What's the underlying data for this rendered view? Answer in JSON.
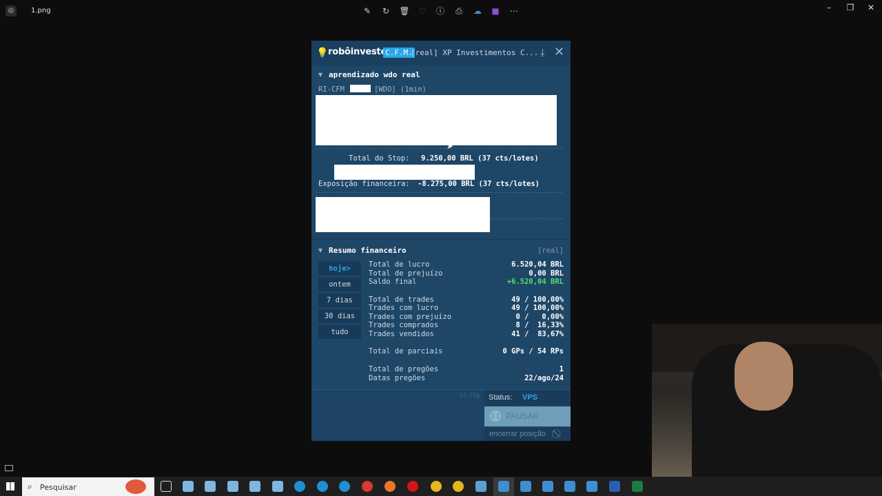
{
  "viewer": {
    "filename": "1.png",
    "toolbar_icons": [
      "edit-icon",
      "rotate-icon",
      "delete-icon",
      "heart-icon",
      "info-icon",
      "print-icon",
      "onedrive-icon",
      "clipchamp-icon",
      "more-icon"
    ]
  },
  "app": {
    "brand": "robôinveste",
    "badge": "C.F.M.",
    "header_text": "[real] XP Investimentos C...",
    "section1": {
      "title": "aprendizado wdo real",
      "subtitle_prefix": "RI-CFM",
      "subtitle_suffix": "[WDO] (1min)",
      "stop_label": "Total do Stop:",
      "stop_value": "9.250,00 BRL (37 cts/lotes)",
      "exposure_label": "Exposição financeira:",
      "exposure_value": "-8.275,00 BRL (37 cts/lotes)"
    },
    "section2": {
      "title": "Resumo financeiro",
      "tag": "[real]",
      "periods": [
        "hoje>",
        "ontem",
        "7 dias",
        "30 dias",
        "tudo"
      ],
      "rows1": [
        {
          "label": "Total de lucro",
          "value": "6.520,04 BRL"
        },
        {
          "label": "Total de prejuízo",
          "value": "0,00 BRL"
        },
        {
          "label": "Saldo final",
          "value": "+6.520,04 BRL"
        }
      ],
      "rows2": [
        {
          "label": "Total de trades",
          "value": "49 / 100,00%"
        },
        {
          "label": "Trades com lucro",
          "value": "49 / 100,00%"
        },
        {
          "label": "Trades com prejuízo",
          "value": "0 /   0,00%"
        },
        {
          "label": "Trades comprados",
          "value": "8 /  16,33%"
        },
        {
          "label": "Trades vendidos",
          "value": "41 /  83,67%"
        }
      ],
      "rows3": [
        {
          "label": "Total de parciais",
          "value": "0 GPs / 54 RPs"
        }
      ],
      "rows4": [
        {
          "label": "Total de pregões",
          "value": "1"
        },
        {
          "label": "Datas pregões",
          "value": "22/ago/24"
        }
      ]
    },
    "footer": {
      "version": "v3.72g",
      "status_label": "Status:",
      "status_value": "VPS",
      "pause_label": "PAUSAR",
      "close_position": "encerrar posição"
    },
    "colors": {
      "accent": "#2aa5e8",
      "positive": "#4fe06a",
      "panel": "#1e4667"
    }
  },
  "taskbar": {
    "search_placeholder": "Pesquisar"
  }
}
